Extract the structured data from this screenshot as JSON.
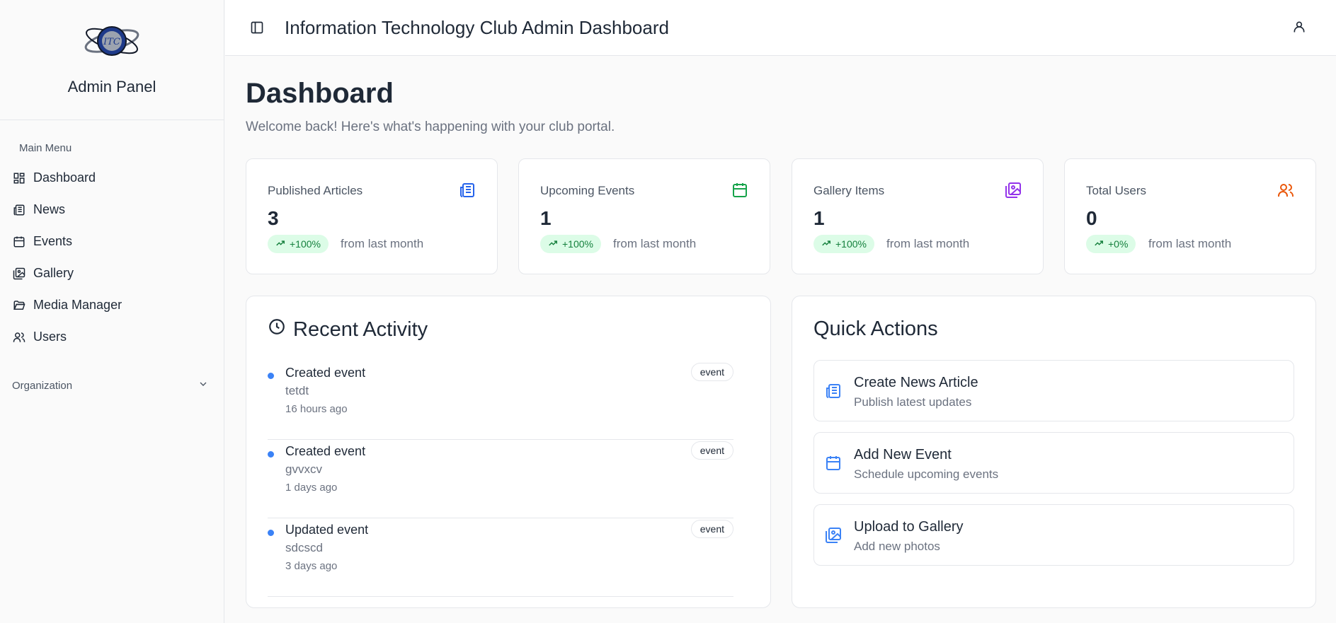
{
  "sidebar": {
    "brand_title": "Admin Panel",
    "logo_text": "ITC",
    "menu_label": "Main Menu",
    "items": [
      {
        "label": "Dashboard",
        "icon": "dashboard-icon"
      },
      {
        "label": "News",
        "icon": "newspaper-icon"
      },
      {
        "label": "Events",
        "icon": "calendar-icon"
      },
      {
        "label": "Gallery",
        "icon": "gallery-icon"
      },
      {
        "label": "Media Manager",
        "icon": "folder-icon"
      },
      {
        "label": "Users",
        "icon": "users-icon"
      }
    ],
    "organization_label": "Organization"
  },
  "header": {
    "title": "Information Technology Club Admin Dashboard"
  },
  "page": {
    "title": "Dashboard",
    "subtitle": "Welcome back! Here's what's happening with your club portal."
  },
  "stats": [
    {
      "label": "Published Articles",
      "value": "3",
      "change": "+100%",
      "note": "from last month",
      "icon": "newspaper-icon",
      "color": "#2563eb"
    },
    {
      "label": "Upcoming Events",
      "value": "1",
      "change": "+100%",
      "note": "from last month",
      "icon": "calendar-icon",
      "color": "#16a34a"
    },
    {
      "label": "Gallery Items",
      "value": "1",
      "change": "+100%",
      "note": "from last month",
      "icon": "gallery-icon",
      "color": "#9333ea"
    },
    {
      "label": "Total Users",
      "value": "0",
      "change": "+0%",
      "note": "from last month",
      "icon": "users-icon",
      "color": "#ea580c"
    }
  ],
  "recent_activity": {
    "title": "Recent Activity",
    "items": [
      {
        "title": "Created event",
        "subject": "tetdt",
        "time": "16 hours ago",
        "badge": "event"
      },
      {
        "title": "Created event",
        "subject": "gvvxcv",
        "time": "1 days ago",
        "badge": "event"
      },
      {
        "title": "Updated event",
        "subject": "sdcscd",
        "time": "3 days ago",
        "badge": "event"
      }
    ]
  },
  "quick_actions": {
    "title": "Quick Actions",
    "items": [
      {
        "title": "Create News Article",
        "subtitle": "Publish latest updates",
        "icon": "newspaper-icon"
      },
      {
        "title": "Add New Event",
        "subtitle": "Schedule upcoming events",
        "icon": "calendar-icon"
      },
      {
        "title": "Upload to Gallery",
        "subtitle": "Add new photos",
        "icon": "gallery-icon"
      }
    ]
  },
  "colors": {
    "accent": "#3b82f6",
    "badge_bg": "#dcfce7",
    "badge_text": "#15803d"
  }
}
